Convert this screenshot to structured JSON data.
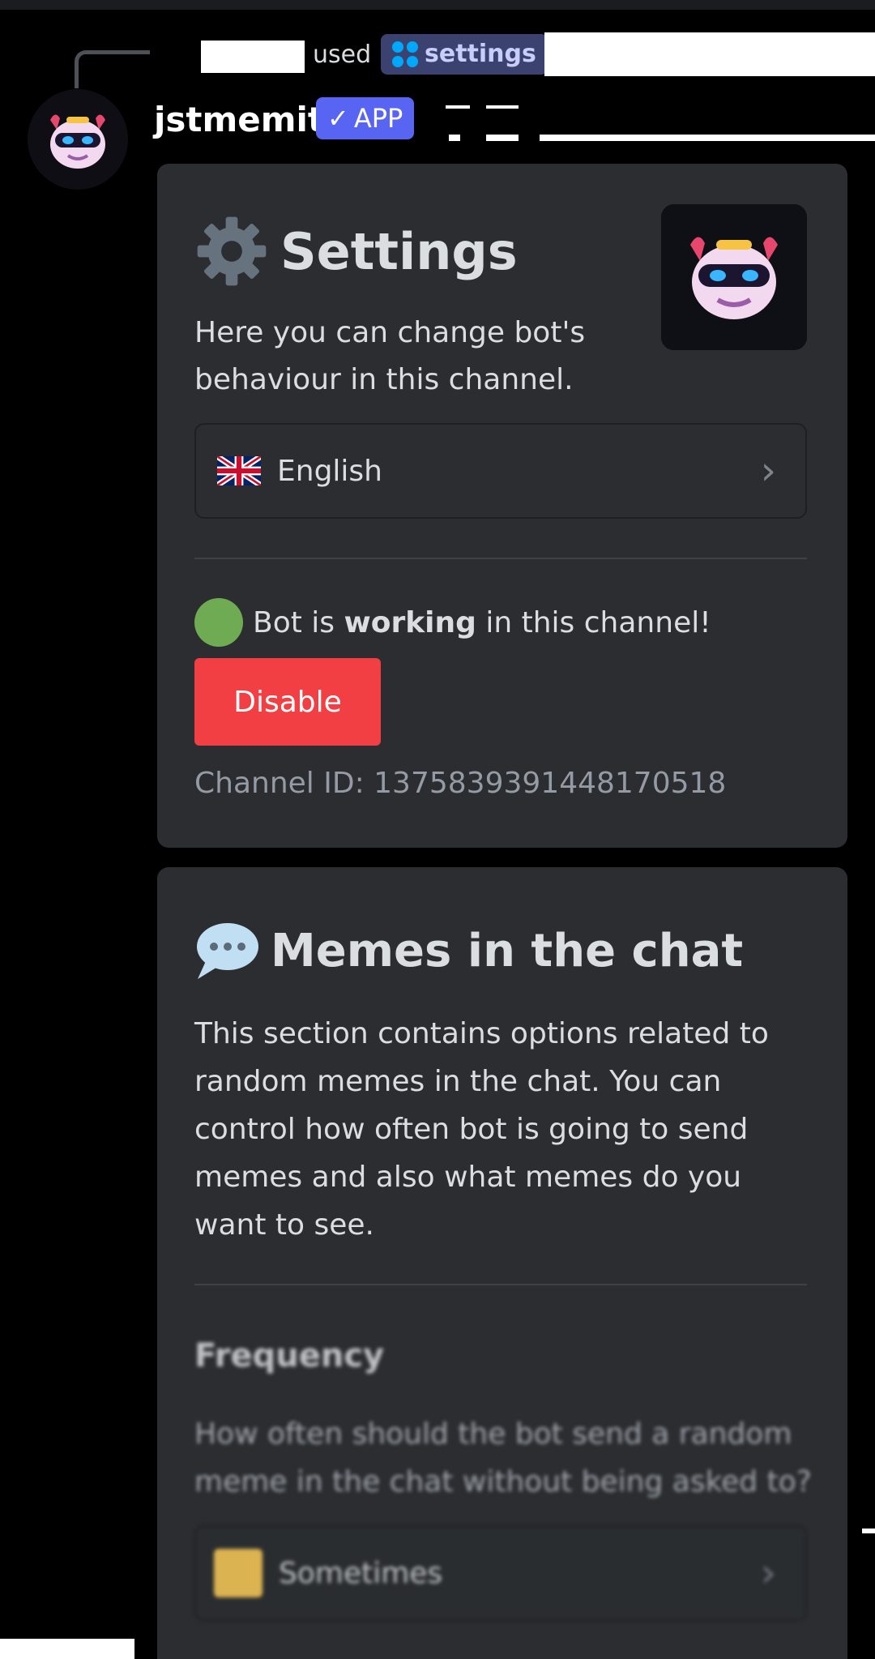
{
  "reply": {
    "used_label": "used",
    "command_name": "settings"
  },
  "message": {
    "username": "jstmemit",
    "app_badge": "APP"
  },
  "settings_embed": {
    "title": "Settings",
    "description": "Here you can change bot's behaviour in this channel.",
    "language_select": {
      "selected": "English",
      "icon": "uk-flag-icon"
    },
    "status_prefix": "Bot is ",
    "status_bold": "working",
    "status_suffix": " in this channel!",
    "disable_button": "Disable",
    "channel_id": "Channel ID: 1375839391448170518"
  },
  "memes_embed": {
    "title": "Memes in the chat",
    "description": "This section contains options related to random memes in the chat. You can control how often bot is going to send memes and also what memes do you want to see.",
    "frequency_title": "Frequency",
    "frequency_description": "How often should the bot send a random meme in the chat without being asked to?",
    "frequency_select": {
      "selected": "Sometimes"
    }
  },
  "colors": {
    "background": "#000000",
    "card": "#2b2d31",
    "accent": "#5865f2",
    "danger": "#f23f43",
    "status_green": "#6fab52"
  }
}
